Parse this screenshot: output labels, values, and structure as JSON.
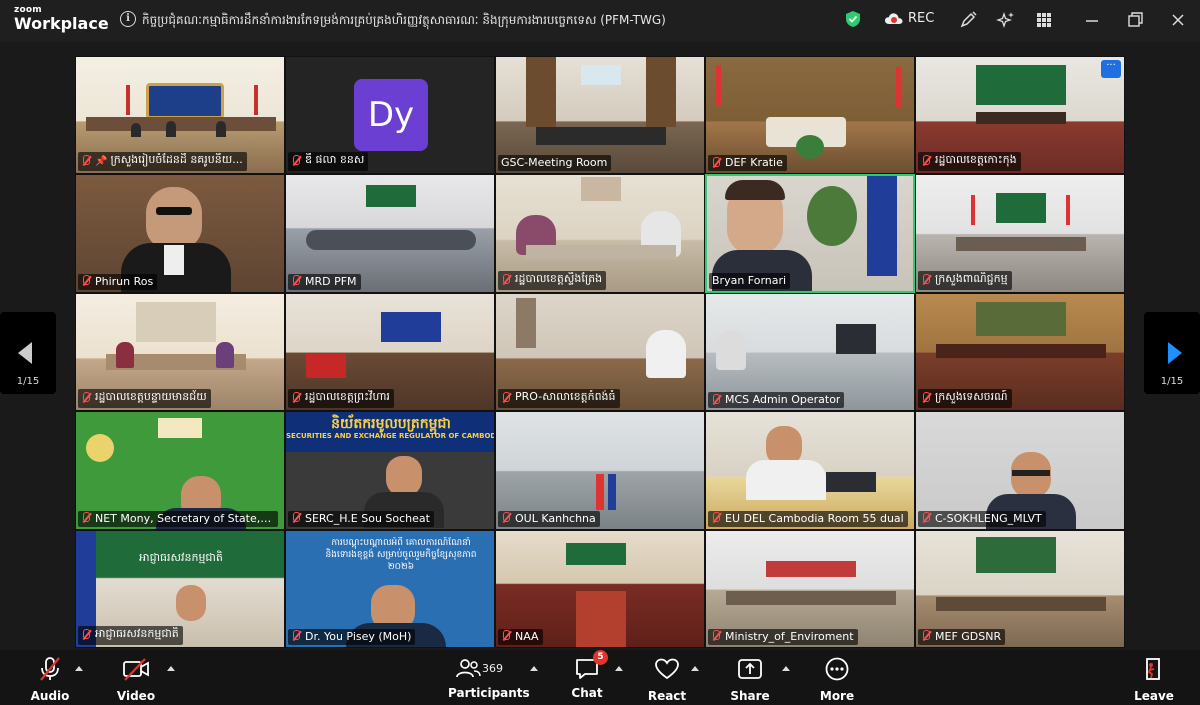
{
  "app": {
    "brand_small": "zoom",
    "brand_large": "Workplace",
    "meeting_title": "កិច្ចប្រជុំគណៈកម្មាធិការដឹកនាំការងារកែទម្រង់ការគ្រប់គ្រងហិរញ្ញវត្ថុសាធារណៈ និងក្រុមការងារបច្ចេកទេស (PFM-TWG)",
    "rec_label": "REC"
  },
  "pagination": {
    "left": "1/15",
    "right": "1/15"
  },
  "participants": [
    {
      "name": "ក្រសួងរៀបចំដែនដី នគរូបនីយ...",
      "pinned": true
    },
    {
      "name": "ឌី ផលា ខនស",
      "avatar_initials": "Dy"
    },
    {
      "name": "GSC-Meeting Room"
    },
    {
      "name": "DEF Kratie"
    },
    {
      "name": "រដ្ឋបាលខេត្តកោះកុង"
    },
    {
      "name": "Phirun Ros"
    },
    {
      "name": "MRD PFM"
    },
    {
      "name": "រដ្ឋបាលខេត្តស្ទឹងត្រែង"
    },
    {
      "name": "Bryan Fornari",
      "speaking": true
    },
    {
      "name": "ក្រសួងពាណិជ្ជកម្ម"
    },
    {
      "name": "រដ្ឋបាលខេត្តបន្ទាយមានជ័យ"
    },
    {
      "name": "រដ្ឋបាលខេត្តព្រះវិហារ"
    },
    {
      "name": "PRO-សាលាខេត្តកំពង់ធំ"
    },
    {
      "name": "MCS Admin Operator"
    },
    {
      "name": "ក្រសួងទេសចរណ៍"
    },
    {
      "name": "NET Mony,  Secretary of State, MEF"
    },
    {
      "name": "SERC_H.E Sou Socheat"
    },
    {
      "name": "OUL Kanhchna"
    },
    {
      "name": "EU DEL Cambodia  Room 55 dual"
    },
    {
      "name": "C-SOKHLENG_MLVT"
    },
    {
      "name": "អាជ្ញាធរសវនកម្មជាតិ"
    },
    {
      "name": "Dr. You Pisey (MoH)"
    },
    {
      "name": "NAA"
    },
    {
      "name": "Ministry_of_Enviroment"
    },
    {
      "name": "MEF GDSNR"
    }
  ],
  "video_text": {
    "serc_banner": "និយ័តករមូលបត្រកម្ពុជា",
    "serc_banner_en": "SECURITIES AND EXCHANGE REGULATOR OF CAMBODIA",
    "moh_banner": "ការបណ្តុះបណ្តាលអំពី គោលការណ៍ណែនាំ និងទោរងខុខ្ពង់ សម្រាប់ចូលរួមកិច្ចខ្សែសុខភាព ២០២៦",
    "naa_banner": "អាជ្ញាធរសវនកម្មជាតិ"
  },
  "toolbar": {
    "audio": "Audio",
    "video": "Video",
    "participants": "Participants",
    "participants_count": "369",
    "chat": "Chat",
    "chat_badge": "5",
    "react": "React",
    "share": "Share",
    "more": "More",
    "leave": "Leave"
  },
  "colors": {
    "accent_blue": "#1e90ff",
    "active_border": "#2ecc71",
    "muted_red": "#ff4d4d",
    "avatar_purple": "#6a3fd1"
  }
}
